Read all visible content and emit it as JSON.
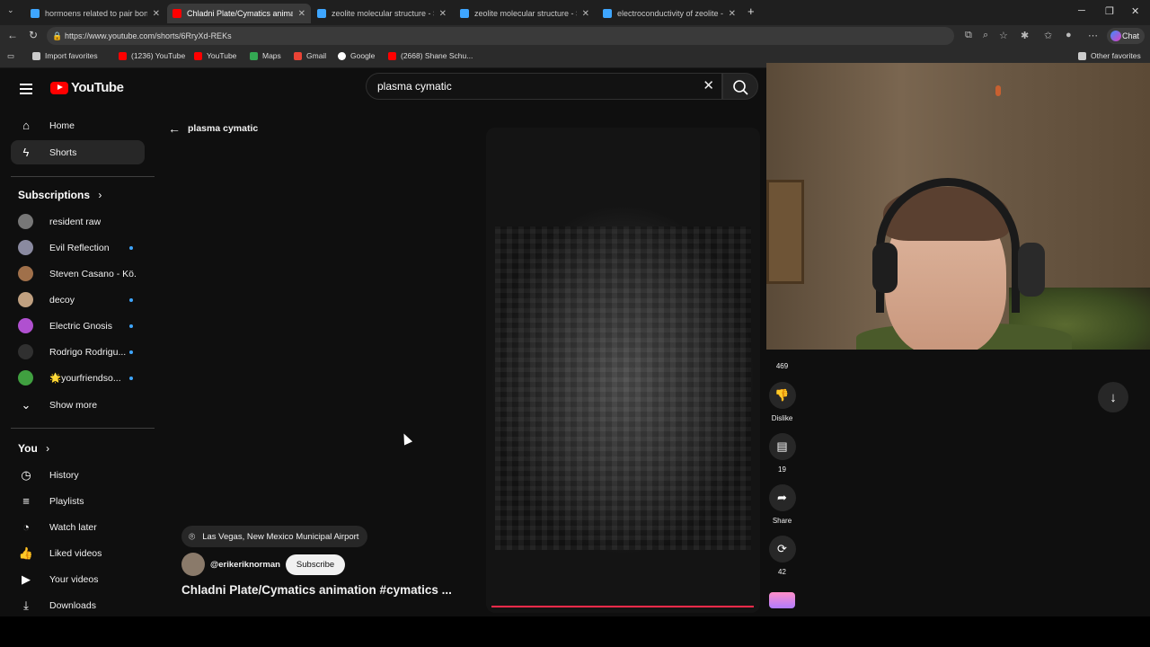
{
  "browser": {
    "tabs": [
      {
        "title": "hormoens related to pair bonding",
        "color": "#3ea6ff"
      },
      {
        "title": "Chladni Plate/Cymatics animation",
        "color": "#ff0000"
      },
      {
        "title": "zeolite molecular structure - Search",
        "color": "#3ea6ff"
      },
      {
        "title": "zeolite molecular structure - Search",
        "color": "#3ea6ff"
      },
      {
        "title": "electroconductivity of zeolite - Search",
        "color": "#3ea6ff"
      }
    ],
    "new_tab": "+",
    "url": "https://www.youtube.com/shorts/6RryXd-REKs",
    "chat_label": "Chat",
    "bookmarks": [
      {
        "label": "Import favorites",
        "color": "#cccccc"
      },
      {
        "label": "(1236) YouTube",
        "color": "#ff0000"
      },
      {
        "label": "YouTube",
        "color": "#ff0000"
      },
      {
        "label": "Maps",
        "color": "#34a853"
      },
      {
        "label": "Gmail",
        "color": "#ea4335"
      },
      {
        "label": "Google",
        "color": "#ffffff"
      },
      {
        "label": "(2668) Shane Schu...",
        "color": "#ff0000"
      }
    ],
    "other_favorites": "Other favorites"
  },
  "youtube": {
    "logo_text": "YouTube",
    "search_value": "plasma cymatic",
    "sidebar": {
      "home": "Home",
      "shorts": "Shorts",
      "subscriptions_heading": "Subscriptions",
      "subscriptions": [
        {
          "label": "resident raw",
          "color": "#777777",
          "dot": false
        },
        {
          "label": "Evil Reflection",
          "color": "#8a8aa0",
          "dot": true
        },
        {
          "label": "Steven Casano - Kö...",
          "color": "#a0704a",
          "dot": false
        },
        {
          "label": "decoy",
          "color": "#c0a080",
          "dot": true
        },
        {
          "label": "Electric Gnosis",
          "color": "#b050d0",
          "dot": true
        },
        {
          "label": "Rodrigo Rodrigu...",
          "color": "#303030",
          "dot": true
        },
        {
          "label": "🌟yourfriendso...",
          "color": "#40a040",
          "dot": true
        }
      ],
      "show_more": "Show more",
      "you_heading": "You",
      "you_items": [
        "History",
        "Playlists",
        "Watch later",
        "Liked videos",
        "Your videos",
        "Downloads"
      ]
    },
    "query_back_label": "plasma cymatic",
    "short": {
      "location": "Las Vegas, New Mexico Municipal Airport",
      "channel": "@erikeriknorman",
      "subscribe": "Subscribe",
      "title": "Chladni Plate/Cymatics animation #cymatics ...",
      "progress_color": "#ff2a4a"
    },
    "actions": {
      "likes": "469",
      "dislike": "Dislike",
      "comments": "19",
      "share": "Share",
      "remix": "42"
    }
  }
}
